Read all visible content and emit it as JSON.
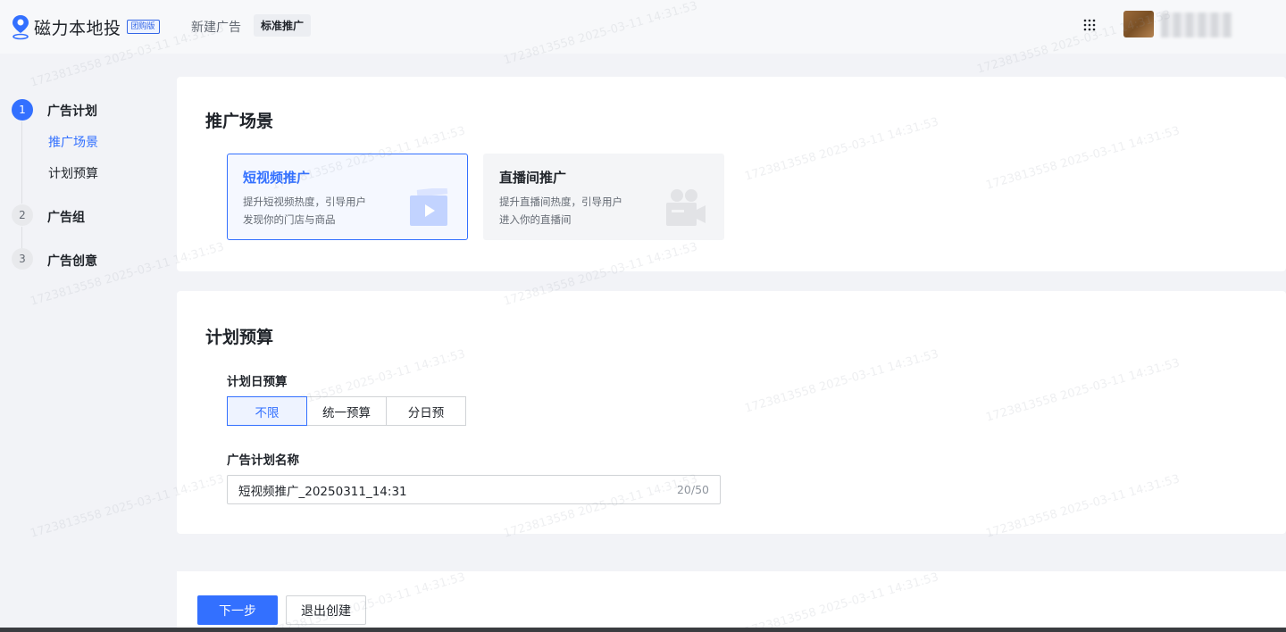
{
  "topbar": {
    "app_name": "磁力本地投",
    "badge": "团购版",
    "crumb_new": "新建广告",
    "crumb_current": "标准推广",
    "apps_icon": "grid-dots-icon",
    "logo_icon": "location-pin-icon"
  },
  "steps": [
    {
      "num": "1",
      "label": "广告计划",
      "state": "active",
      "subitems": [
        {
          "label": "推广场景",
          "active": true
        },
        {
          "label": "计划预算",
          "active": false
        }
      ]
    },
    {
      "num": "2",
      "label": "广告组",
      "state": "idle"
    },
    {
      "num": "3",
      "label": "广告创意",
      "state": "idle"
    }
  ],
  "scene": {
    "title": "推广场景",
    "options": [
      {
        "title": "短视频推广",
        "desc1": "提升短视频热度，引导用户",
        "desc2": "发现你的门店与商品",
        "selected": true,
        "icon": "video-play-icon"
      },
      {
        "title": "直播间推广",
        "desc1": "提升直播间热度，引导用户",
        "desc2": "进入你的直播间",
        "selected": false,
        "icon": "live-camera-icon"
      }
    ]
  },
  "budget": {
    "title": "计划预算",
    "daily_label": "计划日预算",
    "options": [
      "不限",
      "统一预算",
      "分日预"
    ],
    "selected_option": "不限",
    "name_label": "广告计划名称",
    "name_value": "短视频推广_20250311_14:31",
    "name_count": "20/50"
  },
  "footer": {
    "next": "下一步",
    "exit": "退出创建"
  },
  "colors": {
    "accent": "#3370ff",
    "text": "#1f2329",
    "muted": "#646a73"
  }
}
